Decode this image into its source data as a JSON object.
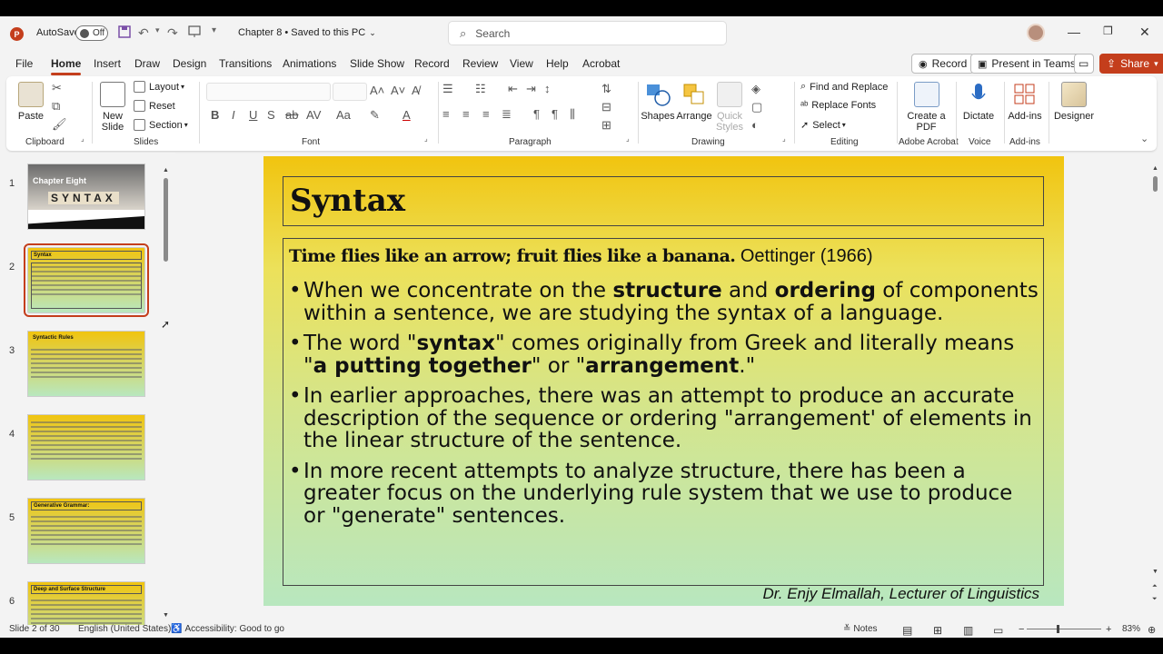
{
  "titlebar": {
    "autosave_label": "AutoSave",
    "autosave_state": "Off",
    "doc_title": "Chapter 8 • Saved to this PC",
    "search_placeholder": "Search"
  },
  "menu": {
    "tabs": [
      "File",
      "Home",
      "Insert",
      "Draw",
      "Design",
      "Transitions",
      "Animations",
      "Slide Show",
      "Record",
      "Review",
      "View",
      "Help",
      "Acrobat"
    ],
    "active_tab": "Home",
    "record_label": "Record",
    "present_label": "Present in Teams",
    "share_label": "Share"
  },
  "ribbon": {
    "clipboard": {
      "paste": "Paste",
      "label": "Clipboard"
    },
    "slides": {
      "new_slide": "New Slide",
      "layout": "Layout",
      "reset": "Reset",
      "section": "Section",
      "label": "Slides"
    },
    "font": {
      "label": "Font"
    },
    "paragraph": {
      "label": "Paragraph"
    },
    "drawing": {
      "shapes": "Shapes",
      "arrange": "Arrange",
      "quick_styles": "Quick Styles",
      "label": "Drawing"
    },
    "editing": {
      "find_replace": "Find and Replace",
      "replace_fonts": "Replace Fonts",
      "select": "Select",
      "label": "Editing"
    },
    "acrobat": {
      "create_pdf": "Create a PDF",
      "label": "Adobe Acrobat"
    },
    "voice": {
      "dictate": "Dictate",
      "label": "Voice"
    },
    "addins": {
      "addins": "Add-ins",
      "label": "Add-ins"
    },
    "designer": {
      "designer": "Designer"
    }
  },
  "thumbnails": [
    {
      "num": "1",
      "title": "Chapter Eight",
      "word": "SYNTAX"
    },
    {
      "num": "2",
      "title": "Syntax"
    },
    {
      "num": "3",
      "title": "Syntactic Rules"
    },
    {
      "num": "4",
      "title": ""
    },
    {
      "num": "5",
      "title": "Generative Grammar:"
    },
    {
      "num": "6",
      "title": "Deep and Surface Structure"
    }
  ],
  "slide": {
    "title": "Syntax",
    "quote_bold": "Time flies like an arrow; fruit flies like a banana.",
    "quote_source": "Oettinger (1966)",
    "b1_a": "When we concentrate on the ",
    "b1_b": "structure",
    "b1_c": " and ",
    "b1_d": "ordering",
    "b1_e": " of components within a sentence, we are studying the syntax of a language.",
    "b2_a": "The word \"",
    "b2_b": "syntax",
    "b2_c": "\" comes originally from Greek and literally means \"",
    "b2_d": "a putting together",
    "b2_e": "\" or \"",
    "b2_f": "arrangement",
    "b2_g": ".\"",
    "b3": "In earlier approaches, there was an attempt to produce an accurate description of the sequence or ordering \"arrangement' of elements in the linear structure of the sentence.",
    "b4": "In more recent attempts to analyze structure, there has been a greater focus on the underlying rule system that we use to produce or \"generate\" sentences.",
    "footer": "Dr. Enjy Elmallah, Lecturer of Linguistics"
  },
  "status": {
    "slide_count": "Slide 2 of 30",
    "language": "English (United States)",
    "accessibility": "Accessibility: Good to go",
    "notes": "Notes",
    "zoom": "83%"
  },
  "colors": {
    "accent": "#c43e1c"
  }
}
